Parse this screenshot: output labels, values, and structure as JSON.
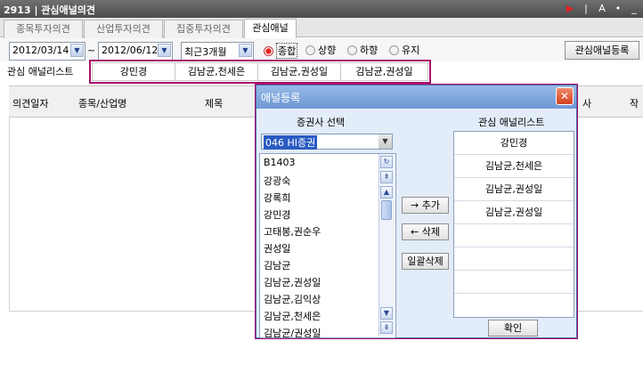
{
  "window": {
    "title": "2913 | 관심애널의견"
  },
  "tabs": [
    {
      "label": "종목투자의견"
    },
    {
      "label": "산업투자의견"
    },
    {
      "label": "집중투자의견"
    },
    {
      "label": "관심애널"
    }
  ],
  "toolbar": {
    "date_from": "2012/03/14",
    "tilde": "~",
    "date_to": "2012/06/12",
    "period": "최근3개월",
    "radios": [
      {
        "label": "종합",
        "selected": true
      },
      {
        "label": "상향",
        "selected": false
      },
      {
        "label": "하향",
        "selected": false
      },
      {
        "label": "유지",
        "selected": false
      }
    ],
    "register_button": "관심애널등록"
  },
  "analyst_row": {
    "label": "관심 애널리스트",
    "items": [
      "강민경",
      "김남균,천세은",
      "김남균,권성일",
      "김남균,권성일"
    ]
  },
  "grid": {
    "columns": [
      "의견일자",
      "종목/산업명",
      "제목",
      "사",
      "작"
    ]
  },
  "dialog": {
    "title": "애널등록",
    "left_header": "증권사 선택",
    "right_header": "관심 애널리스트",
    "broker_select": "046 HI증권",
    "analysts": [
      "B1403",
      "강광숙",
      "강록희",
      "강민경",
      "고태봉,권순우",
      "권성일",
      "김남균",
      "김남균,권성일",
      "김남균,김익상",
      "김남균,천세은",
      "김남균/권성일"
    ],
    "favorites": [
      "강민경",
      "김남균,천세은",
      "김남균,권성일",
      "김남균,권성일",
      "",
      "",
      "",
      "",
      ""
    ],
    "add_button": "→ 추가",
    "delete_button": "← 삭제",
    "delete_all_button": "일괄삭제",
    "ok_button": "확인"
  }
}
